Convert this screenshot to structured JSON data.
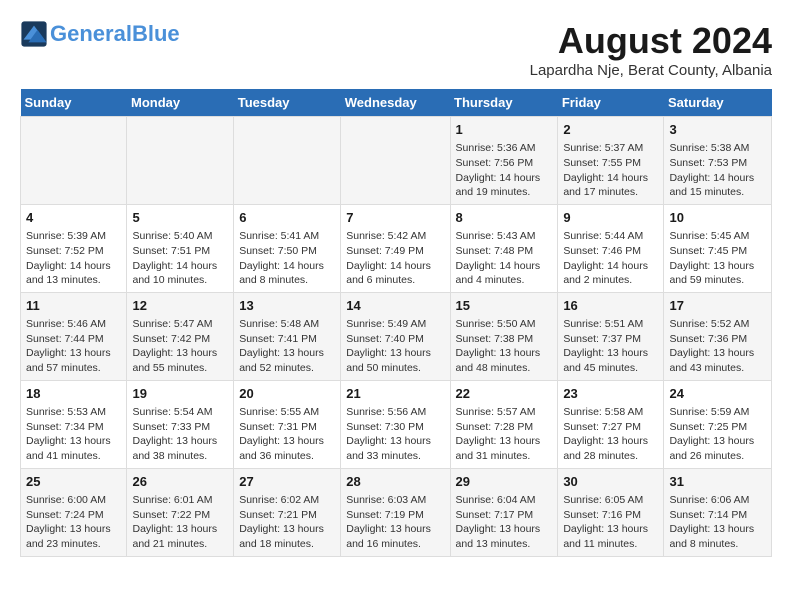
{
  "header": {
    "logo_line1": "General",
    "logo_line2": "Blue",
    "month_year": "August 2024",
    "location": "Lapardha Nje, Berat County, Albania"
  },
  "days_of_week": [
    "Sunday",
    "Monday",
    "Tuesday",
    "Wednesday",
    "Thursday",
    "Friday",
    "Saturday"
  ],
  "weeks": [
    [
      {
        "day": "",
        "content": ""
      },
      {
        "day": "",
        "content": ""
      },
      {
        "day": "",
        "content": ""
      },
      {
        "day": "",
        "content": ""
      },
      {
        "day": "1",
        "content": "Sunrise: 5:36 AM\nSunset: 7:56 PM\nDaylight: 14 hours\nand 19 minutes."
      },
      {
        "day": "2",
        "content": "Sunrise: 5:37 AM\nSunset: 7:55 PM\nDaylight: 14 hours\nand 17 minutes."
      },
      {
        "day": "3",
        "content": "Sunrise: 5:38 AM\nSunset: 7:53 PM\nDaylight: 14 hours\nand 15 minutes."
      }
    ],
    [
      {
        "day": "4",
        "content": "Sunrise: 5:39 AM\nSunset: 7:52 PM\nDaylight: 14 hours\nand 13 minutes."
      },
      {
        "day": "5",
        "content": "Sunrise: 5:40 AM\nSunset: 7:51 PM\nDaylight: 14 hours\nand 10 minutes."
      },
      {
        "day": "6",
        "content": "Sunrise: 5:41 AM\nSunset: 7:50 PM\nDaylight: 14 hours\nand 8 minutes."
      },
      {
        "day": "7",
        "content": "Sunrise: 5:42 AM\nSunset: 7:49 PM\nDaylight: 14 hours\nand 6 minutes."
      },
      {
        "day": "8",
        "content": "Sunrise: 5:43 AM\nSunset: 7:48 PM\nDaylight: 14 hours\nand 4 minutes."
      },
      {
        "day": "9",
        "content": "Sunrise: 5:44 AM\nSunset: 7:46 PM\nDaylight: 14 hours\nand 2 minutes."
      },
      {
        "day": "10",
        "content": "Sunrise: 5:45 AM\nSunset: 7:45 PM\nDaylight: 13 hours\nand 59 minutes."
      }
    ],
    [
      {
        "day": "11",
        "content": "Sunrise: 5:46 AM\nSunset: 7:44 PM\nDaylight: 13 hours\nand 57 minutes."
      },
      {
        "day": "12",
        "content": "Sunrise: 5:47 AM\nSunset: 7:42 PM\nDaylight: 13 hours\nand 55 minutes."
      },
      {
        "day": "13",
        "content": "Sunrise: 5:48 AM\nSunset: 7:41 PM\nDaylight: 13 hours\nand 52 minutes."
      },
      {
        "day": "14",
        "content": "Sunrise: 5:49 AM\nSunset: 7:40 PM\nDaylight: 13 hours\nand 50 minutes."
      },
      {
        "day": "15",
        "content": "Sunrise: 5:50 AM\nSunset: 7:38 PM\nDaylight: 13 hours\nand 48 minutes."
      },
      {
        "day": "16",
        "content": "Sunrise: 5:51 AM\nSunset: 7:37 PM\nDaylight: 13 hours\nand 45 minutes."
      },
      {
        "day": "17",
        "content": "Sunrise: 5:52 AM\nSunset: 7:36 PM\nDaylight: 13 hours\nand 43 minutes."
      }
    ],
    [
      {
        "day": "18",
        "content": "Sunrise: 5:53 AM\nSunset: 7:34 PM\nDaylight: 13 hours\nand 41 minutes."
      },
      {
        "day": "19",
        "content": "Sunrise: 5:54 AM\nSunset: 7:33 PM\nDaylight: 13 hours\nand 38 minutes."
      },
      {
        "day": "20",
        "content": "Sunrise: 5:55 AM\nSunset: 7:31 PM\nDaylight: 13 hours\nand 36 minutes."
      },
      {
        "day": "21",
        "content": "Sunrise: 5:56 AM\nSunset: 7:30 PM\nDaylight: 13 hours\nand 33 minutes."
      },
      {
        "day": "22",
        "content": "Sunrise: 5:57 AM\nSunset: 7:28 PM\nDaylight: 13 hours\nand 31 minutes."
      },
      {
        "day": "23",
        "content": "Sunrise: 5:58 AM\nSunset: 7:27 PM\nDaylight: 13 hours\nand 28 minutes."
      },
      {
        "day": "24",
        "content": "Sunrise: 5:59 AM\nSunset: 7:25 PM\nDaylight: 13 hours\nand 26 minutes."
      }
    ],
    [
      {
        "day": "25",
        "content": "Sunrise: 6:00 AM\nSunset: 7:24 PM\nDaylight: 13 hours\nand 23 minutes."
      },
      {
        "day": "26",
        "content": "Sunrise: 6:01 AM\nSunset: 7:22 PM\nDaylight: 13 hours\nand 21 minutes."
      },
      {
        "day": "27",
        "content": "Sunrise: 6:02 AM\nSunset: 7:21 PM\nDaylight: 13 hours\nand 18 minutes."
      },
      {
        "day": "28",
        "content": "Sunrise: 6:03 AM\nSunset: 7:19 PM\nDaylight: 13 hours\nand 16 minutes."
      },
      {
        "day": "29",
        "content": "Sunrise: 6:04 AM\nSunset: 7:17 PM\nDaylight: 13 hours\nand 13 minutes."
      },
      {
        "day": "30",
        "content": "Sunrise: 6:05 AM\nSunset: 7:16 PM\nDaylight: 13 hours\nand 11 minutes."
      },
      {
        "day": "31",
        "content": "Sunrise: 6:06 AM\nSunset: 7:14 PM\nDaylight: 13 hours\nand 8 minutes."
      }
    ]
  ]
}
